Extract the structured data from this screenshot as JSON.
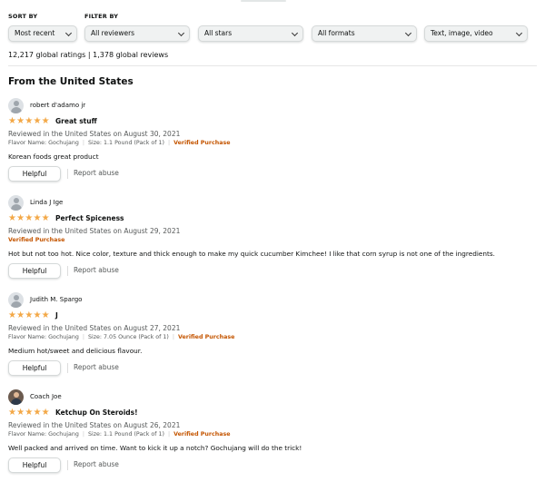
{
  "filters": {
    "sort_label": "SORT BY",
    "filter_label": "FILTER BY",
    "sort_value": "Most recent",
    "reviewers_value": "All reviewers",
    "stars_value": "All stars",
    "formats_value": "All formats",
    "media_value": "Text, image, video"
  },
  "summary": {
    "ratings_text": "12,217 global ratings | 1,378 global reviews"
  },
  "section_title": "From the United States",
  "actions": {
    "helpful_label": "Helpful",
    "report_label": "Report abuse"
  },
  "reviews": [
    {
      "name": "robert d'adamo jr",
      "rating": 5,
      "title": "Great stuff",
      "date": "Reviewed in the United States on August 30, 2021",
      "flavor": "Flavor Name: Gochujang",
      "size": "Size: 1.1 Pound (Pack of 1)",
      "verified": "Verified Purchase",
      "body": "Korean foods great product"
    },
    {
      "name": "Linda J Ige",
      "rating": 5,
      "title": "Perfect Spiceness",
      "date": "Reviewed in the United States on August 29, 2021",
      "verified": "Verified Purchase",
      "body": "Hot but not too hot. Nice color, texture and thick enough to make my quick cucumber Kimchee! I like that corn syrup is not one of the ingredients."
    },
    {
      "name": "Judith M. Spargo",
      "rating": 5,
      "title": "J",
      "date": "Reviewed in the United States on August 27, 2021",
      "flavor": "Flavor Name: Gochujang",
      "size": "Size: 7.05 Ounce (Pack of 1)",
      "verified": "Verified Purchase",
      "body": "Medium hot/sweet and delicious flavour."
    },
    {
      "name": "Coach Joe",
      "rating": 5,
      "title": "Ketchup On Steroids!",
      "date": "Reviewed in the United States on August 26, 2021",
      "flavor": "Flavor Name: Gochujang",
      "size": "Size: 1.1 Pound (Pack of 1)",
      "verified": "Verified Purchase",
      "body": "Well packed and arrived on time. Want to kick it up a notch? Gochujang will do the trick!"
    }
  ],
  "colors": {
    "star": "#f3a847",
    "verified": "#c45500",
    "muted_text": "#565959"
  },
  "icons": {
    "star": "star-icon",
    "dropdown": "chevron-down-icon",
    "avatar_default": "default-avatar-icon",
    "avatar_photo": "user-photo-avatar"
  }
}
